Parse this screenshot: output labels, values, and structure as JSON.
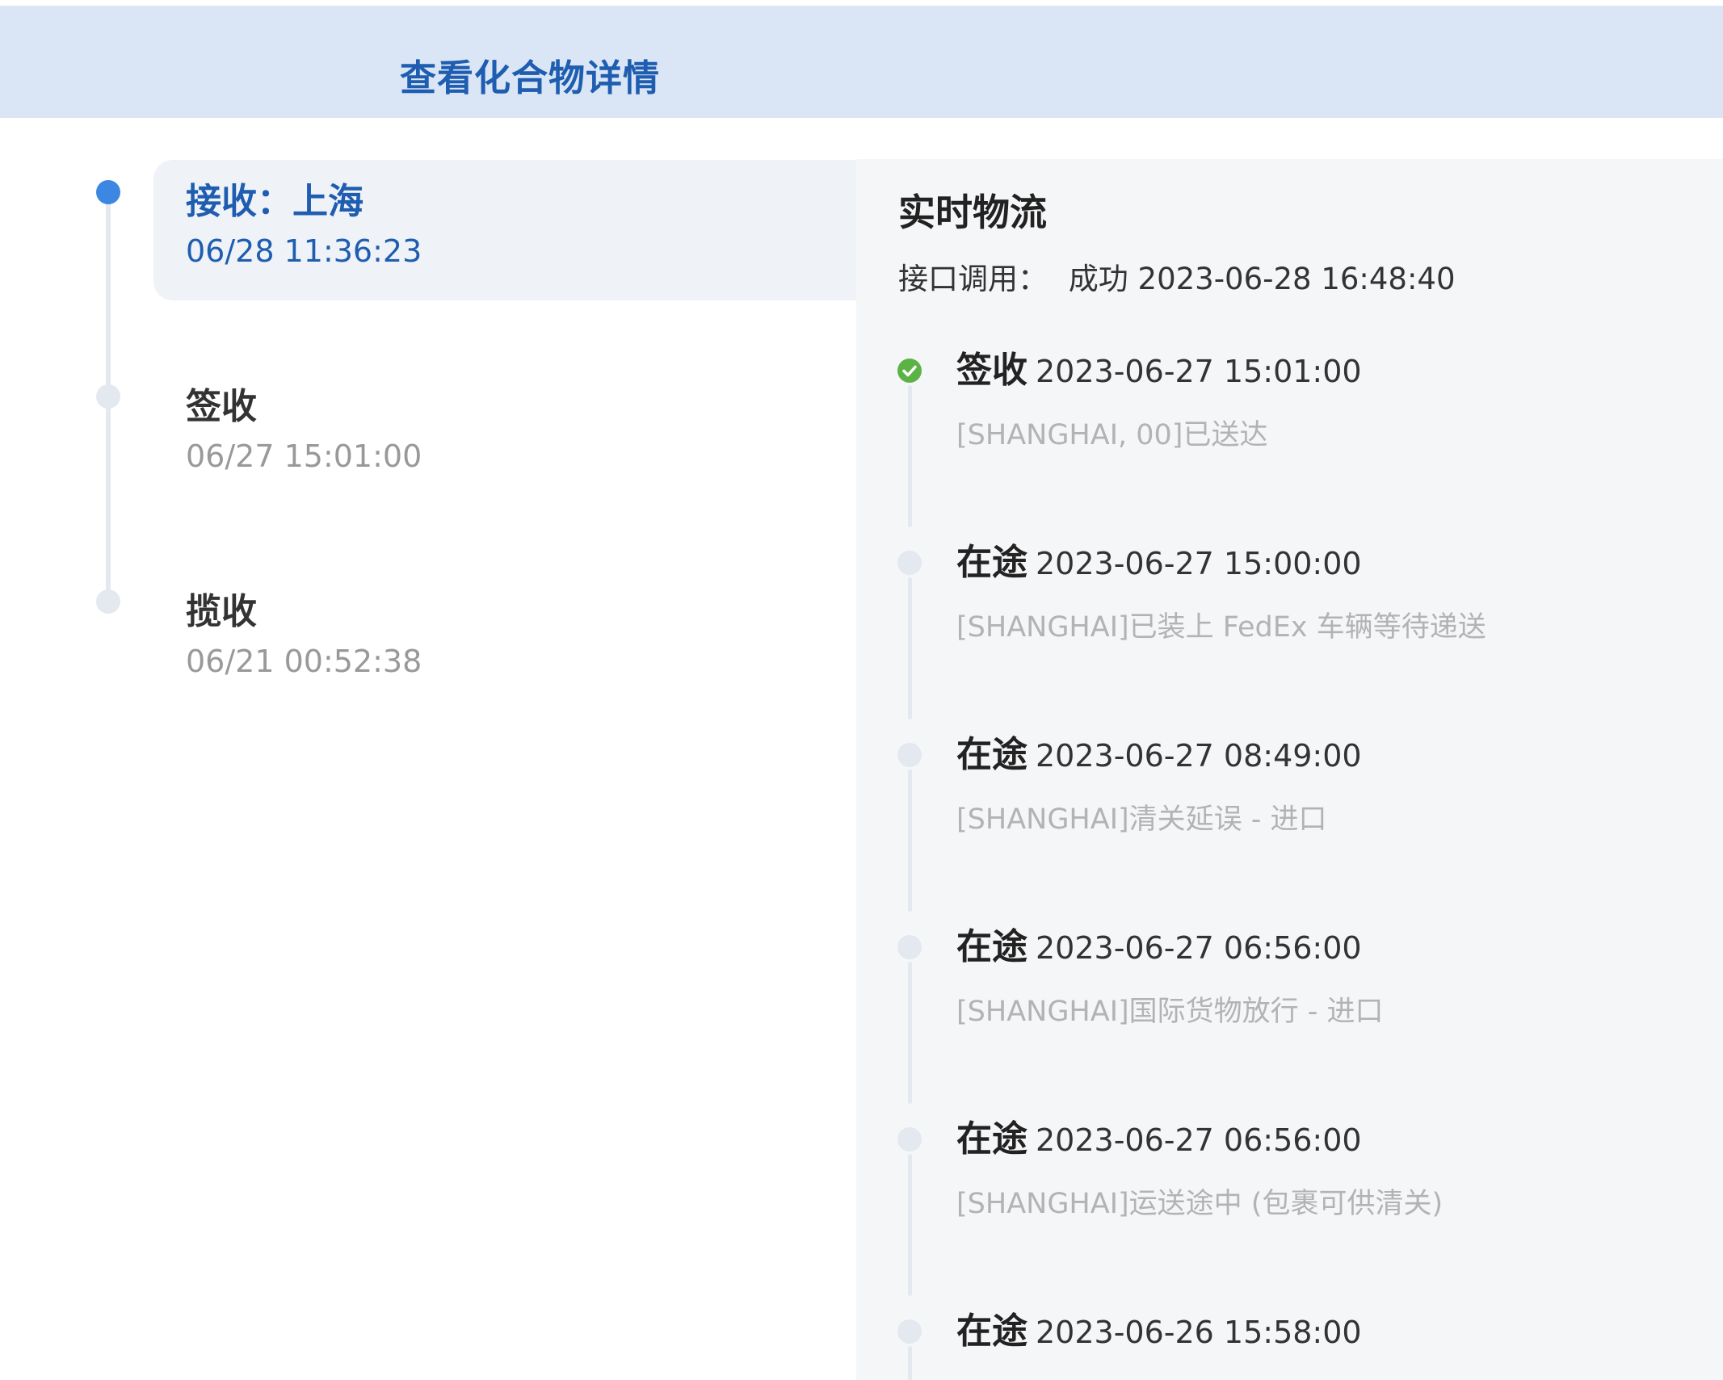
{
  "header": {
    "title": "查看化合物详情"
  },
  "left_timeline": [
    {
      "status": "接收：上海",
      "time": "06/28 11:36:23",
      "active": true
    },
    {
      "status": "签收",
      "time": "06/27 15:01:00",
      "active": false
    },
    {
      "status": "揽收",
      "time": "06/21 00:52:38",
      "active": false
    }
  ],
  "realtime": {
    "title": "实时物流",
    "api_label": "接口调用：",
    "api_status": "成功",
    "api_time": "2023-06-28 16:48:40",
    "events": [
      {
        "status": "签收",
        "time": "2023-06-27 15:01:00",
        "desc": "[SHANGHAI, 00]已送达",
        "done": true
      },
      {
        "status": "在途",
        "time": "2023-06-27 15:00:00",
        "desc": "[SHANGHAI]已装上 FedEx 车辆等待递送",
        "done": false
      },
      {
        "status": "在途",
        "time": "2023-06-27 08:49:00",
        "desc": "[SHANGHAI]清关延误 - 进口",
        "done": false
      },
      {
        "status": "在途",
        "time": "2023-06-27 06:56:00",
        "desc": "[SHANGHAI]国际货物放行 - 进口",
        "done": false
      },
      {
        "status": "在途",
        "time": "2023-06-27 06:56:00",
        "desc": "[SHANGHAI]运送途中 (包裹可供清关)",
        "done": false
      },
      {
        "status": "在途",
        "time": "2023-06-26 15:58:00",
        "desc": "",
        "done": false
      }
    ]
  },
  "colors": {
    "header_bg": "#dae6f5",
    "accent_blue": "#1e5db0",
    "active_dot": "#3b87e1",
    "success_green": "#5bb346",
    "panel_bg": "#f5f6f8"
  }
}
